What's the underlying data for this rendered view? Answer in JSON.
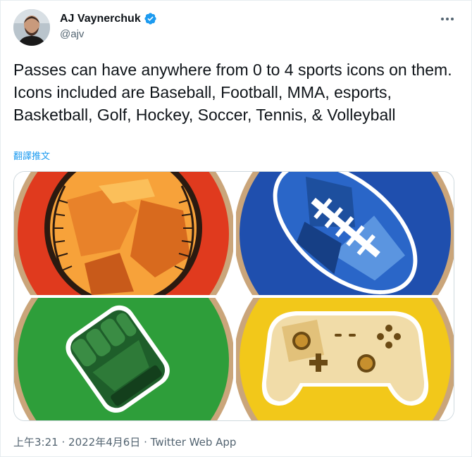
{
  "author": {
    "display_name": "AJ Vaynerchuk",
    "handle": "@ajv",
    "verified": true
  },
  "tweet": {
    "text": "Passes can have anywhere from 0 to 4 sports icons on them. Icons included are Baseball, Football, MMA, esports, Basketball, Golf, Hockey, Soccer, Tennis, & Volleyball",
    "translate_label": "翻譯推文"
  },
  "media": {
    "icons": [
      "baseball-icon",
      "football-icon",
      "mma-glove-icon",
      "esports-controller-icon"
    ],
    "colors": {
      "baseball_bg": "#e03a1e",
      "football_bg": "#1f4fae",
      "mma_bg": "#2e9e3a",
      "esports_bg": "#f2c81a",
      "rim": "#caa57a"
    }
  },
  "footer": {
    "time": "上午3:21",
    "separator1": "·",
    "date": "2022年4月6日",
    "separator2": "·",
    "source": "Twitter Web App"
  }
}
